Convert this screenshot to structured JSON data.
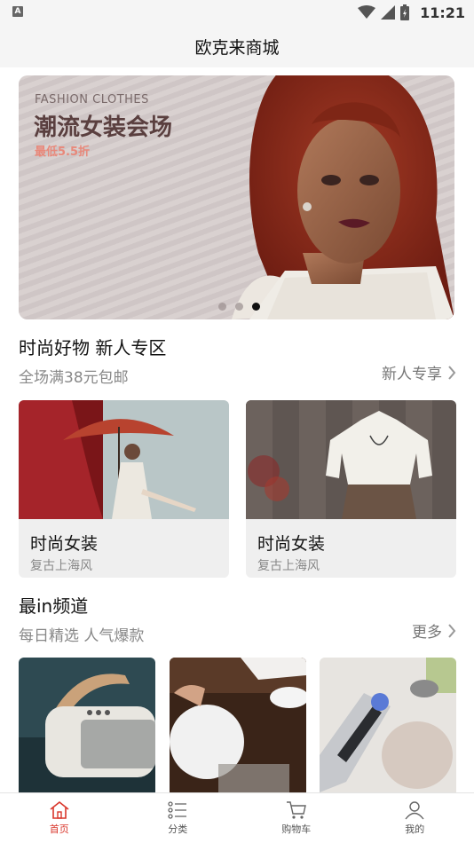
{
  "status_bar": {
    "time": "11:21",
    "notif_letter": "A"
  },
  "header": {
    "title": "欧克来商城"
  },
  "banner": {
    "title_en": "FASHION CLOTHES",
    "title_cn": "潮流女装会场",
    "discount": "最低5.5折",
    "slide_count": 3,
    "active_slide": 3
  },
  "section1": {
    "title": "时尚好物 新人专区",
    "subtitle": "全场满38元包邮",
    "more": "新人专享",
    "cards": [
      {
        "title": "时尚女装",
        "subtitle": "复古上海风"
      },
      {
        "title": "时尚女装",
        "subtitle": "复古上海风"
      }
    ]
  },
  "section2": {
    "title": "最in频道",
    "subtitle": "每日精选 人气爆款",
    "more": "更多"
  },
  "tabs": [
    {
      "label": "首页",
      "icon": "home-icon",
      "active": true
    },
    {
      "label": "分类",
      "icon": "list-icon",
      "active": false
    },
    {
      "label": "购物车",
      "icon": "cart-icon",
      "active": false
    },
    {
      "label": "我的",
      "icon": "user-icon",
      "active": false
    }
  ],
  "colors": {
    "accent": "#d9362b",
    "background": "#ffffff",
    "header_bg": "#f5f5f5"
  }
}
